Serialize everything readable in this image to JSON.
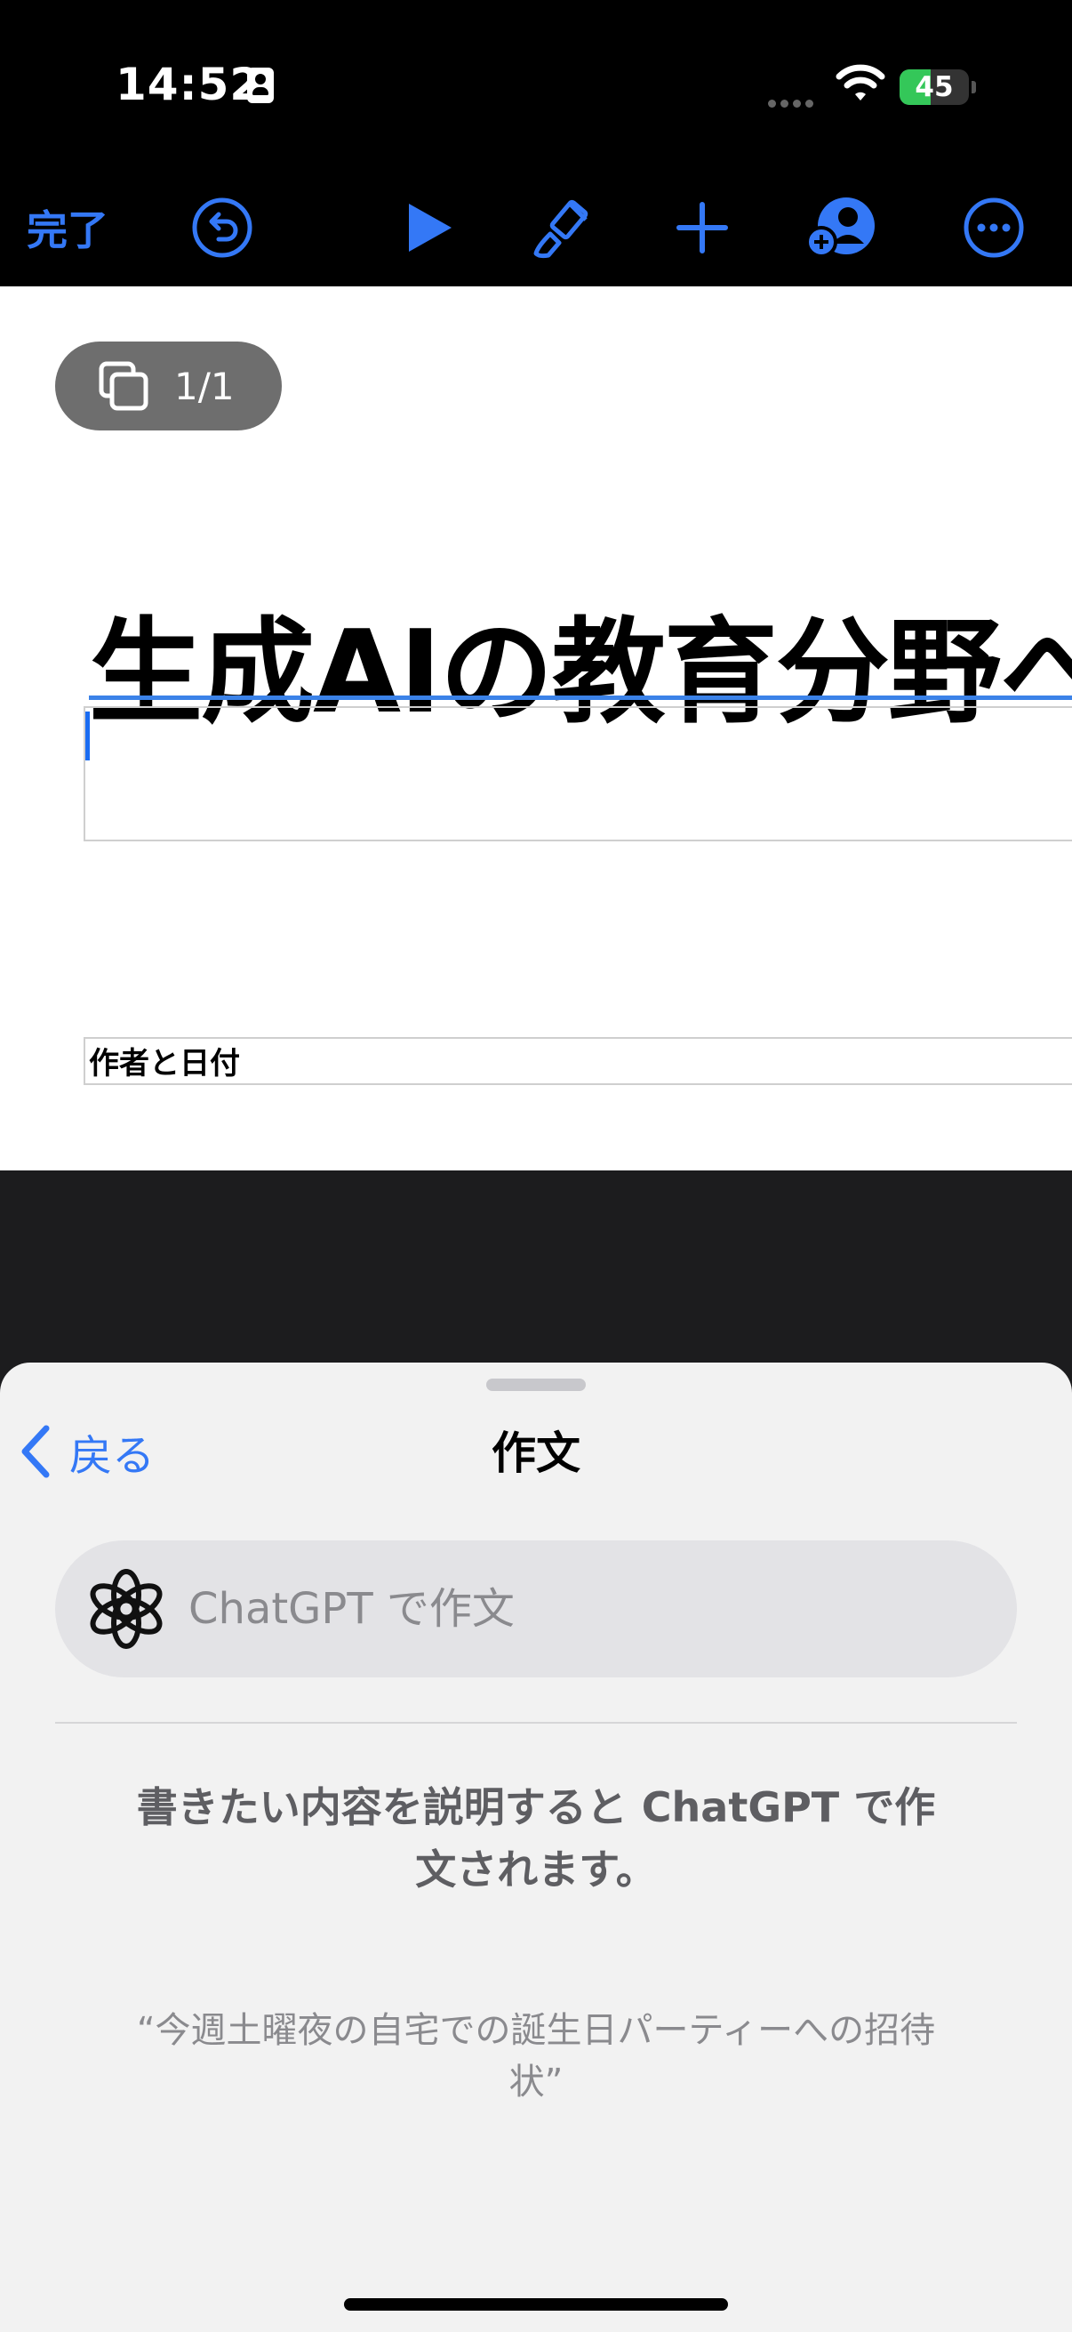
{
  "status_bar": {
    "time": "14:52",
    "battery_level": "45"
  },
  "toolbar": {
    "done_label": "完了",
    "icons": [
      "undo-icon",
      "play-icon",
      "paintbrush-icon",
      "plus-icon",
      "collaborate-icon",
      "more-icon"
    ],
    "accent_color": "#3478f6"
  },
  "document": {
    "page_indicator": "1/1",
    "title_text": "生成AIの教育分野への",
    "author_placeholder": "作者と日付"
  },
  "sheet": {
    "back_label": "戻る",
    "title": "作文",
    "prompt_placeholder": "ChatGPT で作文",
    "description": "書きたい内容を説明すると ChatGPT で作文されます。",
    "example": "“今週土曜夜の自宅での誕生日パーティーへの招待状”"
  }
}
